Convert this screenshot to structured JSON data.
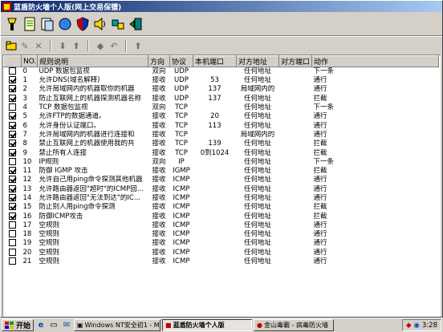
{
  "window": {
    "title": "蓝盾防火墙个人版(网上交易保镖)"
  },
  "toolbar": {
    "main_icons": [
      "flashlight-icon",
      "notebook-icon",
      "document-list-icon",
      "globe-icon",
      "shield-icon",
      "speaker-icon",
      "puzzle-icon",
      "exit-door-icon"
    ],
    "rule_icons": [
      "add-rule-icon",
      "edit-rule-icon",
      "delete-rule-icon",
      "move-down-icon",
      "move-up-icon",
      "back-icon",
      "undo-icon",
      "apply-icon"
    ]
  },
  "table": {
    "columns": [
      "",
      "NO.",
      "规则说明",
      "方向",
      "协议",
      "本机端口",
      "对方地址",
      "对方端口",
      "动作"
    ],
    "rows": [
      {
        "checked": false,
        "no": "0",
        "desc": "UDP 数据包监视",
        "dir": "双向",
        "proto": "UDP",
        "lport": "",
        "raddr": "任何地址",
        "rport": "",
        "action": "下一条"
      },
      {
        "checked": true,
        "no": "1",
        "desc": "允许DNS(域名解释)",
        "dir": "接收",
        "proto": "UDP",
        "lport": "53",
        "raddr": "任何地址",
        "rport": "",
        "action": "通行"
      },
      {
        "checked": true,
        "no": "2",
        "desc": "允许局域网内的机器取你的机器",
        "dir": "接收",
        "proto": "UDP",
        "lport": "137",
        "raddr": "局域网内的",
        "rport": "",
        "action": "通行"
      },
      {
        "checked": true,
        "no": "3",
        "desc": "防止互联网上的机器探测机器名称",
        "dir": "接收",
        "proto": "UDP",
        "lport": "137",
        "raddr": "任何地址",
        "rport": "",
        "action": "拦截"
      },
      {
        "checked": false,
        "no": "4",
        "desc": "TCP 数据包监视",
        "dir": "双向",
        "proto": "TCP",
        "lport": "",
        "raddr": "任何地址",
        "rport": "",
        "action": "下一条"
      },
      {
        "checked": true,
        "no": "5",
        "desc": "允许FTP的数据通道。",
        "dir": "接收",
        "proto": "TCP",
        "lport": "20",
        "raddr": "任何地址",
        "rport": "",
        "action": "通行"
      },
      {
        "checked": true,
        "no": "6",
        "desc": "允许身份认证端口。",
        "dir": "接收",
        "proto": "TCP",
        "lport": "113",
        "raddr": "任何地址",
        "rport": "",
        "action": "通行"
      },
      {
        "checked": true,
        "no": "7",
        "desc": "允许局域网内的机器进行连接和",
        "dir": "接收",
        "proto": "TCP",
        "lport": "",
        "raddr": "局域网内的",
        "rport": "",
        "action": "通行"
      },
      {
        "checked": true,
        "no": "8",
        "desc": "禁止互联网上的机器使用我的共",
        "dir": "接收",
        "proto": "TCP",
        "lport": "139",
        "raddr": "任何地址",
        "rport": "",
        "action": "拦截"
      },
      {
        "checked": true,
        "no": "9",
        "desc": "禁止所有人连接",
        "dir": "接收",
        "proto": "TCP",
        "lport": "0到1024",
        "raddr": "任何地址",
        "rport": "",
        "action": "拦截"
      },
      {
        "checked": false,
        "no": "10",
        "desc": "IP规则",
        "dir": "双向",
        "proto": "IP",
        "lport": "",
        "raddr": "任何地址",
        "rport": "",
        "action": "下一条"
      },
      {
        "checked": true,
        "no": "11",
        "desc": "防御 IGMP 攻击",
        "dir": "接收",
        "proto": "IGMP",
        "lport": "",
        "raddr": "任何地址",
        "rport": "",
        "action": "拦截"
      },
      {
        "checked": true,
        "no": "12",
        "desc": "允许自己用ping命令探测其他机器",
        "dir": "接收",
        "proto": "ICMP",
        "lport": "",
        "raddr": "任何地址",
        "rport": "",
        "action": "通行"
      },
      {
        "checked": true,
        "no": "13",
        "desc": "允许路由器返回\"超时\"的ICMP回...",
        "dir": "接收",
        "proto": "ICMP",
        "lport": "",
        "raddr": "任何地址",
        "rport": "",
        "action": "通行"
      },
      {
        "checked": true,
        "no": "14",
        "desc": "允许路由器返回\"无法到达\"的IC...",
        "dir": "接收",
        "proto": "ICMP",
        "lport": "",
        "raddr": "任何地址",
        "rport": "",
        "action": "通行"
      },
      {
        "checked": true,
        "no": "15",
        "desc": "防止别人用ping命令探测",
        "dir": "接收",
        "proto": "ICMP",
        "lport": "",
        "raddr": "任何地址",
        "rport": "",
        "action": "拦截"
      },
      {
        "checked": true,
        "no": "16",
        "desc": "防御ICMP攻击",
        "dir": "接收",
        "proto": "ICMP",
        "lport": "",
        "raddr": "任何地址",
        "rport": "",
        "action": "拦截"
      },
      {
        "checked": false,
        "no": "17",
        "desc": "空规则",
        "dir": "接收",
        "proto": "ICMP",
        "lport": "",
        "raddr": "任何地址",
        "rport": "",
        "action": "通行"
      },
      {
        "checked": false,
        "no": "18",
        "desc": "空规则",
        "dir": "接收",
        "proto": "ICMP",
        "lport": "",
        "raddr": "任何地址",
        "rport": "",
        "action": "通行"
      },
      {
        "checked": false,
        "no": "19",
        "desc": "空规则",
        "dir": "接收",
        "proto": "ICMP",
        "lport": "",
        "raddr": "任何地址",
        "rport": "",
        "action": "通行"
      },
      {
        "checked": false,
        "no": "20",
        "desc": "空规则",
        "dir": "接收",
        "proto": "ICMP",
        "lport": "",
        "raddr": "任何地址",
        "rport": "",
        "action": "通行"
      },
      {
        "checked": false,
        "no": "21",
        "desc": "空规则",
        "dir": "接收",
        "proto": "ICMP",
        "lport": "",
        "raddr": "任何地址",
        "rport": "",
        "action": "通行"
      }
    ]
  },
  "taskbar": {
    "start_label": "开始",
    "tasks": [
      {
        "label": "Windows NT安全初1 - Mi...",
        "pressed": false
      },
      {
        "label": "蓝盾防火墙个人版",
        "pressed": true
      },
      {
        "label": "金山毒霸 - 病毒防火墙",
        "pressed": false
      }
    ],
    "clock": "3:28"
  }
}
